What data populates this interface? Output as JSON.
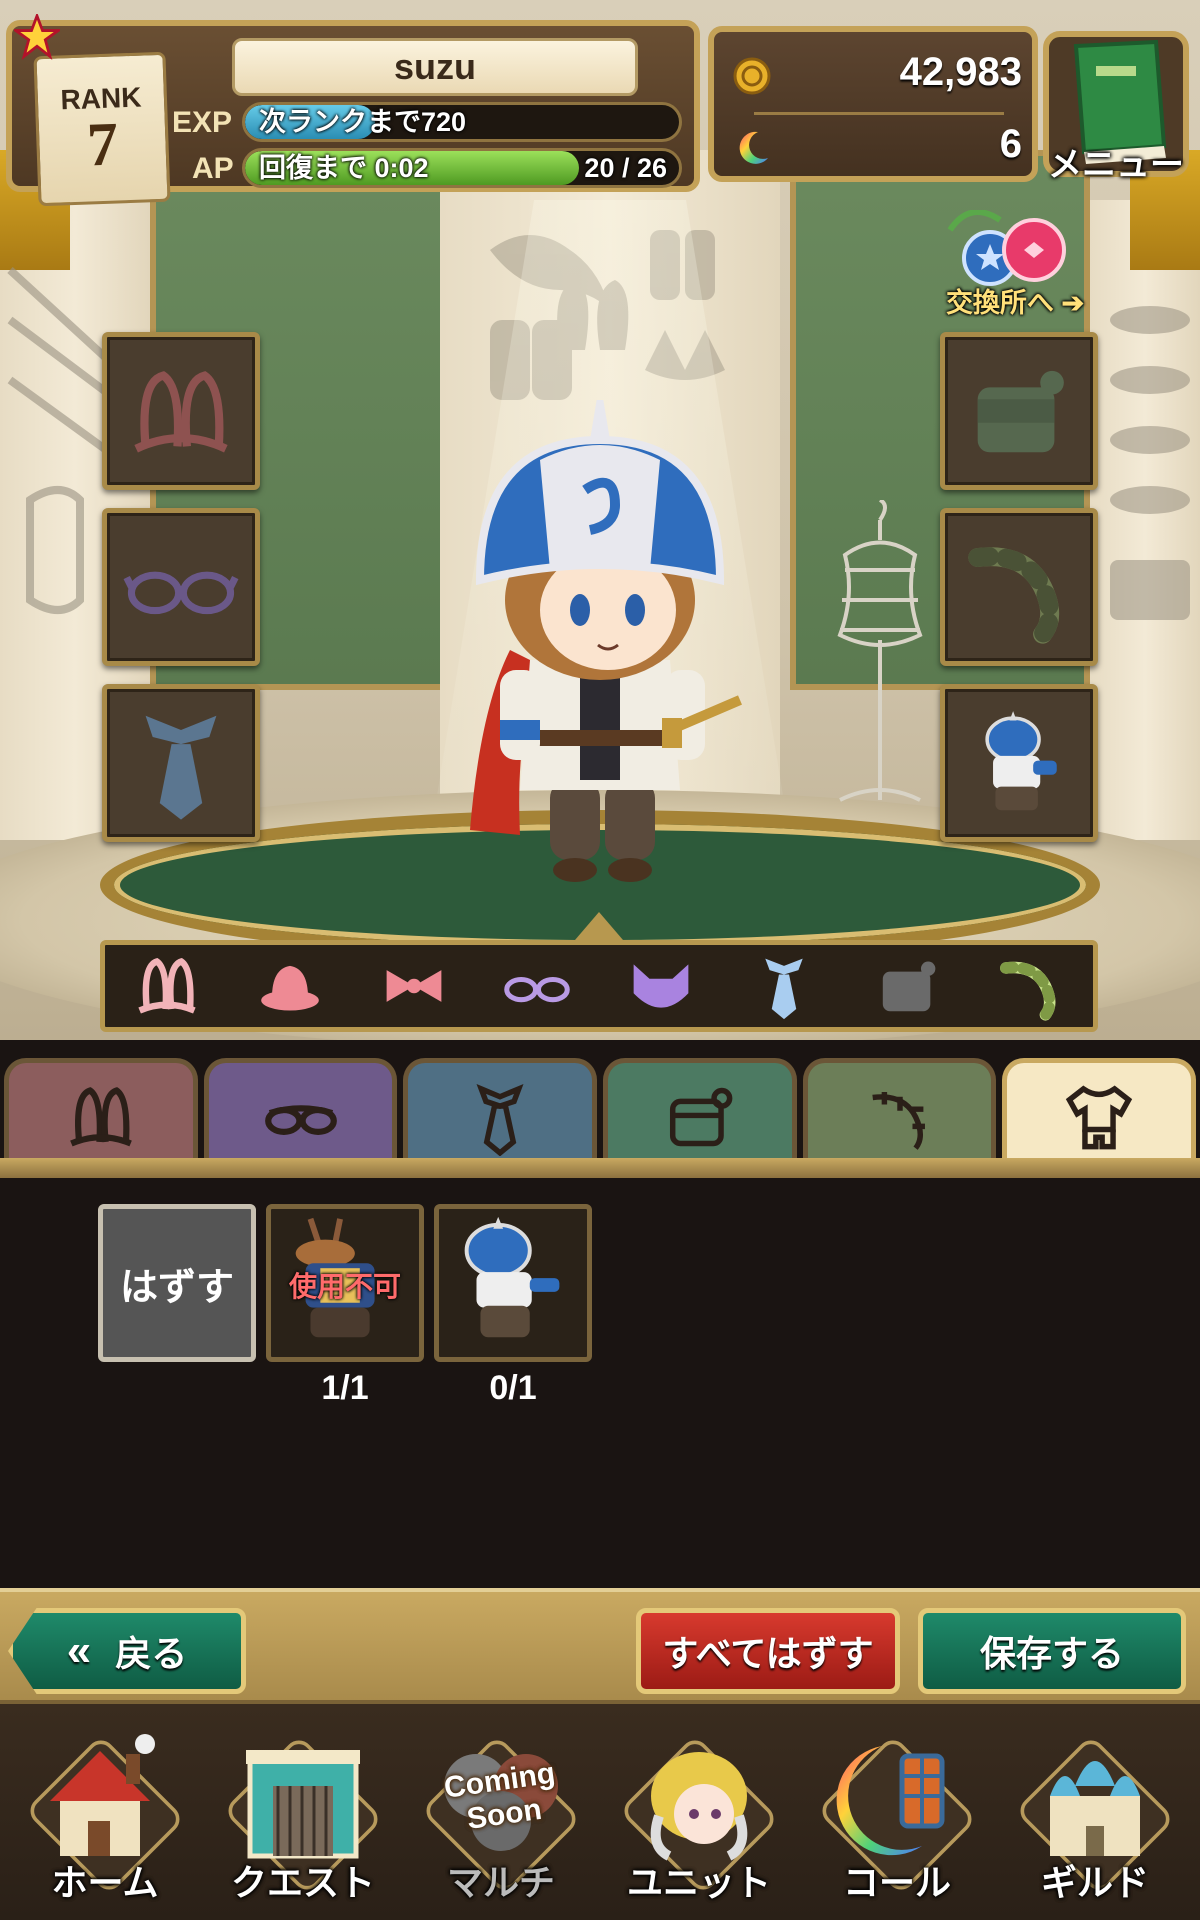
{
  "player": {
    "rank_label": "RANK",
    "rank": "7",
    "name": "suzu",
    "exp_label": "EXP",
    "exp_text": "次ランクまで720",
    "exp_progress": 0.3,
    "ap_label": "AP",
    "ap_text": "回復まで 0:02",
    "ap_count": "20 / 26",
    "ap_progress": 0.77
  },
  "currency": {
    "coins": "42,983",
    "coin_icon": "gold-coin-icon",
    "moons": "6",
    "moon_icon": "rainbow-moon-icon"
  },
  "menu": {
    "label": "メニュー",
    "icon": "green-book-icon"
  },
  "exchange": {
    "label": "交換所へ",
    "icon": "exchange-orbs-icon"
  },
  "slots": {
    "left": [
      "ears-slot",
      "glasses-slot",
      "tie-slot"
    ],
    "right": [
      "bag-slot",
      "tail-slot",
      "outfit-slot"
    ]
  },
  "category_strip": [
    "rabbit-ears-icon",
    "hat-icon",
    "ribbon-icon",
    "glasses-icon",
    "cat-mask-icon",
    "tie-icon",
    "bag-icon",
    "tail-icon"
  ],
  "tabs": [
    {
      "name": "ears",
      "color": "#8c5d5d"
    },
    {
      "name": "glasses",
      "color": "#6e5a8a"
    },
    {
      "name": "tie",
      "color": "#4f6f84"
    },
    {
      "name": "bag",
      "color": "#4c7a62"
    },
    {
      "name": "tail",
      "color": "#6c7e58"
    },
    {
      "name": "outfit",
      "color": "#f6e8c4",
      "active": true
    }
  ],
  "inventory": {
    "unequip_label": "はずす",
    "items": [
      {
        "status": "使用不可",
        "count": "1/1"
      },
      {
        "status": "",
        "count": "0/1"
      }
    ]
  },
  "actions": {
    "back": "戻る",
    "unequip_all": "すべてはずす",
    "save": "保存する"
  },
  "nav": {
    "home": "ホーム",
    "quest": "クエスト",
    "multi": "マルチ",
    "multi_badge": "Coming Soon",
    "unit": "ユニット",
    "call": "コール",
    "guild": "ギルド"
  },
  "colors": {
    "gold_frame": "#c4a258",
    "exp_bar": "#3aa6c9",
    "ap_bar": "#6fbf3a",
    "danger": "#d83a2e",
    "confirm": "#1f8a6a"
  }
}
